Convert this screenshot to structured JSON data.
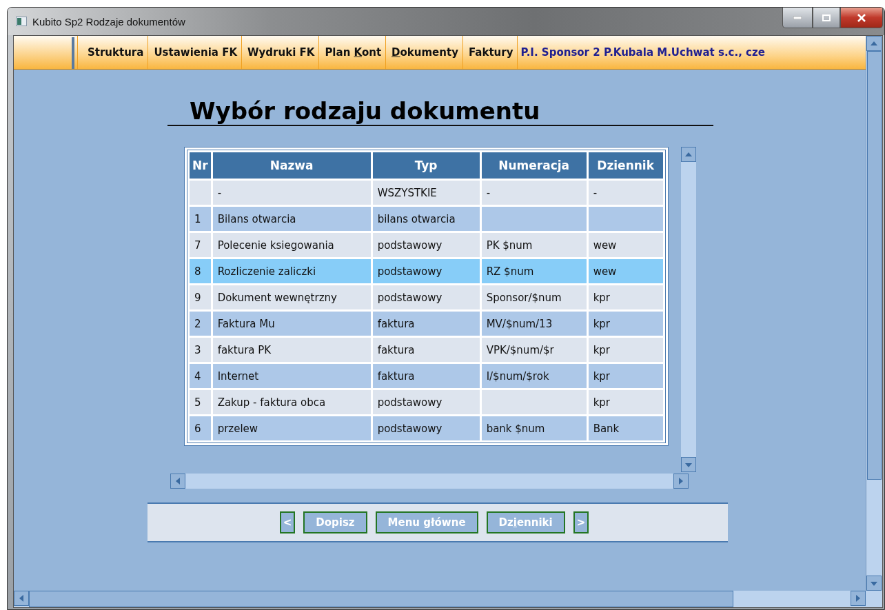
{
  "window": {
    "title": "Kubito Sp2 Rodzaje dokumentów"
  },
  "menu": [
    {
      "parts": [
        {
          "text": "Struktura",
          "underlined": false
        }
      ]
    },
    {
      "parts": [
        {
          "text": "Ustawienia FK",
          "underlined": false
        }
      ]
    },
    {
      "parts": [
        {
          "text": "Wydruki FK",
          "underlined": false
        }
      ]
    },
    {
      "parts": [
        {
          "text": "Plan ",
          "underlined": false
        },
        {
          "text": "K",
          "underlined": true
        },
        {
          "text": "ont",
          "underlined": false
        }
      ]
    },
    {
      "parts": [
        {
          "text": "D",
          "underlined": true
        },
        {
          "text": "okumenty",
          "underlined": false
        }
      ]
    },
    {
      "parts": [
        {
          "text": "Faktury",
          "underlined": false
        }
      ]
    }
  ],
  "company": "P.I. Sponsor 2 P.Kubala M.Uchwat s.c., cze",
  "heading": "Wybór rodzaju dokumentu",
  "table": {
    "columns": [
      "Nr",
      "Nazwa",
      "Typ",
      "Numeracja",
      "Dziennik"
    ],
    "rows": [
      {
        "cells": [
          "",
          "-",
          "WSZYSTKIE",
          "-",
          "-"
        ],
        "selected": false
      },
      {
        "cells": [
          "1",
          "Bilans otwarcia",
          "bilans otwarcia",
          "",
          ""
        ],
        "selected": false
      },
      {
        "cells": [
          "7",
          "Polecenie ksiegowania",
          "podstawowy",
          "PK $num",
          "wew"
        ],
        "selected": false
      },
      {
        "cells": [
          "8",
          "Rozliczenie zaliczki",
          "podstawowy",
          "RZ $num",
          "wew"
        ],
        "selected": true
      },
      {
        "cells": [
          "9",
          "Dokument wewnętrzny",
          "podstawowy",
          "Sponsor/$num",
          "kpr"
        ],
        "selected": false
      },
      {
        "cells": [
          "2",
          "Faktura Mu",
          "faktura",
          "MV/$num/13",
          "kpr"
        ],
        "selected": false
      },
      {
        "cells": [
          "3",
          "faktura PK",
          "faktura",
          "VPK/$num/$r",
          "kpr"
        ],
        "selected": false
      },
      {
        "cells": [
          "4",
          "Internet",
          "faktura",
          "I/$num/$rok",
          "kpr"
        ],
        "selected": false
      },
      {
        "cells": [
          "5",
          "Zakup - faktura obca",
          "podstawowy",
          "",
          "kpr"
        ],
        "selected": false
      },
      {
        "cells": [
          "6",
          "przelew",
          "podstawowy",
          "bank $num",
          "Bank"
        ],
        "selected": false
      }
    ]
  },
  "buttons": [
    {
      "kind": "nav",
      "parts": [
        {
          "text": "<",
          "underlined": false
        }
      ]
    },
    {
      "kind": "wide",
      "parts": [
        {
          "text": "Dopisz",
          "underlined": false
        }
      ]
    },
    {
      "kind": "wide",
      "parts": [
        {
          "text": "Menu główne",
          "underlined": false
        }
      ]
    },
    {
      "kind": "wide",
      "parts": [
        {
          "text": "Dz",
          "underlined": false
        },
        {
          "text": "i",
          "underlined": true
        },
        {
          "text": "enniki",
          "underlined": false
        }
      ]
    },
    {
      "kind": "nav",
      "parts": [
        {
          "text": ">",
          "underlined": false
        }
      ]
    }
  ]
}
